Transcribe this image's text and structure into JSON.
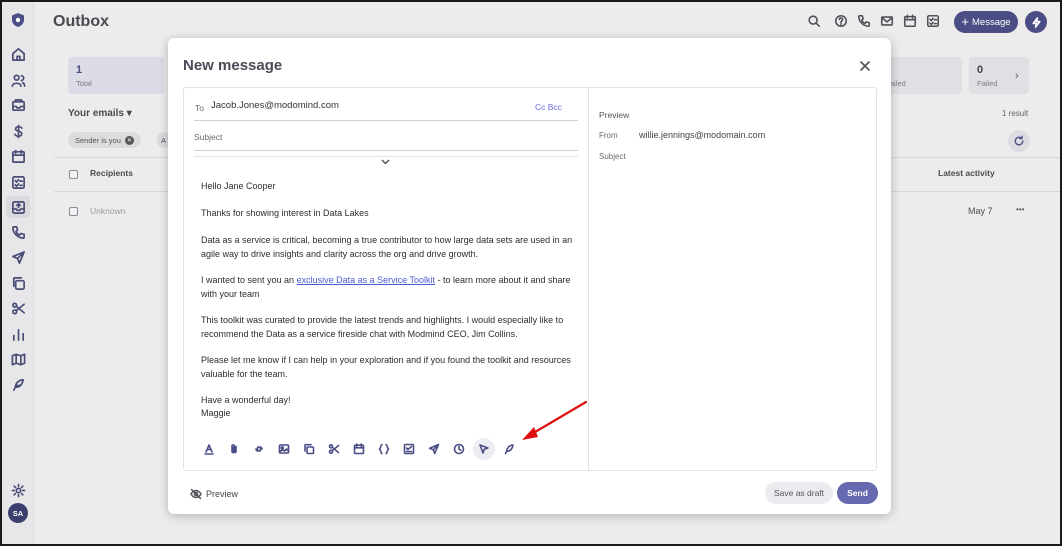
{
  "page": {
    "title": "Outbox",
    "new_message_button": "Message",
    "stats": [
      {
        "count": "1",
        "label": "Total"
      },
      {
        "count": "",
        "label": "ailed"
      },
      {
        "count": "0",
        "label": "Failed"
      }
    ],
    "your_emails_label": "Your emails",
    "filter_chip": "Sender is you",
    "filter_chip_partial": "A",
    "results_count": "1 result",
    "table": {
      "col_recipients": "Recipients",
      "col_latest_activity": "Latest activity",
      "rows": [
        {
          "recipient": "Unknown",
          "date": "May 7",
          "more": "•••"
        }
      ]
    },
    "avatar_initials": "SA"
  },
  "modal": {
    "title": "New message",
    "to_label": "To",
    "to_value": "Jacob.Jones@modomind.com",
    "cc_bcc": "Cc Bcc",
    "subject_placeholder": "Subject",
    "body": {
      "greeting": "Hello Jane Cooper",
      "p1": "Thanks for showing interest in Data Lakes",
      "p2": "Data as a service is critical, becoming a true contributor to how large data sets are used in an agile way to drive insights and clarity across the org and drive growth.",
      "p3_before": "I wanted to sent you an ",
      "p3_link": "exclusive Data as a Service Toolkit",
      "p3_after": " - to learn more about it and share with your team",
      "p4": "This toolkit was curated to provide the latest trends and highlights. I would especially like to recommend the Data as a service fireside chat with Modmind CEO, Jim Collins.",
      "p5": "Please let me know if I can help in your exploration and if you found the toolkit and resources valuable for the team.",
      "closing": "Have a wonderful day!",
      "signature": "Maggie"
    },
    "preview": {
      "label": "Preview",
      "from_label": "From",
      "from_value": "willie.jennings@modomain.com",
      "subject_label": "Subject"
    },
    "footer": {
      "preview_toggle": "Preview",
      "save_draft": "Save as draft",
      "send": "Send"
    }
  },
  "colors": {
    "accent": "#4b4d85",
    "send_button": "#6668b0",
    "link": "#4a5bd6",
    "annotation_arrow": "#e01010"
  }
}
